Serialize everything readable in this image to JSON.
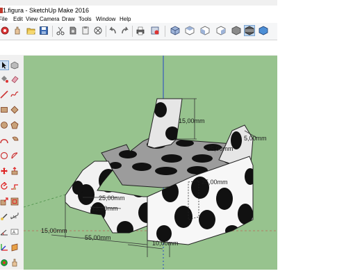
{
  "window": {
    "title": "1.figura - SketchUp Make 2016"
  },
  "menu": [
    "File",
    "Edit",
    "View",
    "Camera",
    "Draw",
    "Tools",
    "Window",
    "Help"
  ],
  "toolbar_icons": [
    "orbit-tool-icon",
    "pan-tool-icon",
    "folder-open-icon",
    "save-icon",
    "cut-icon",
    "copy-icon",
    "paste-icon",
    "erase-icon",
    "undo-icon",
    "redo-icon",
    "print-icon",
    "model-info-icon",
    "iso-view-icon",
    "top-view-icon",
    "front-view-icon",
    "right-view-icon",
    "back-view-icon",
    "left-view-icon",
    "xray-style-icon",
    "shaded-style-icon"
  ],
  "viewport": {
    "background": "#97c38e",
    "dimensions": {
      "d1": "15,00mm",
      "d2": "25,00mm",
      "d3": "5,00mm",
      "d4": "25,00mm",
      "d5": "25,00mm",
      "d6": "15,00mm",
      "d7": "15,00mm",
      "d8": "55,00mm",
      "d9": "10,00mm"
    }
  }
}
